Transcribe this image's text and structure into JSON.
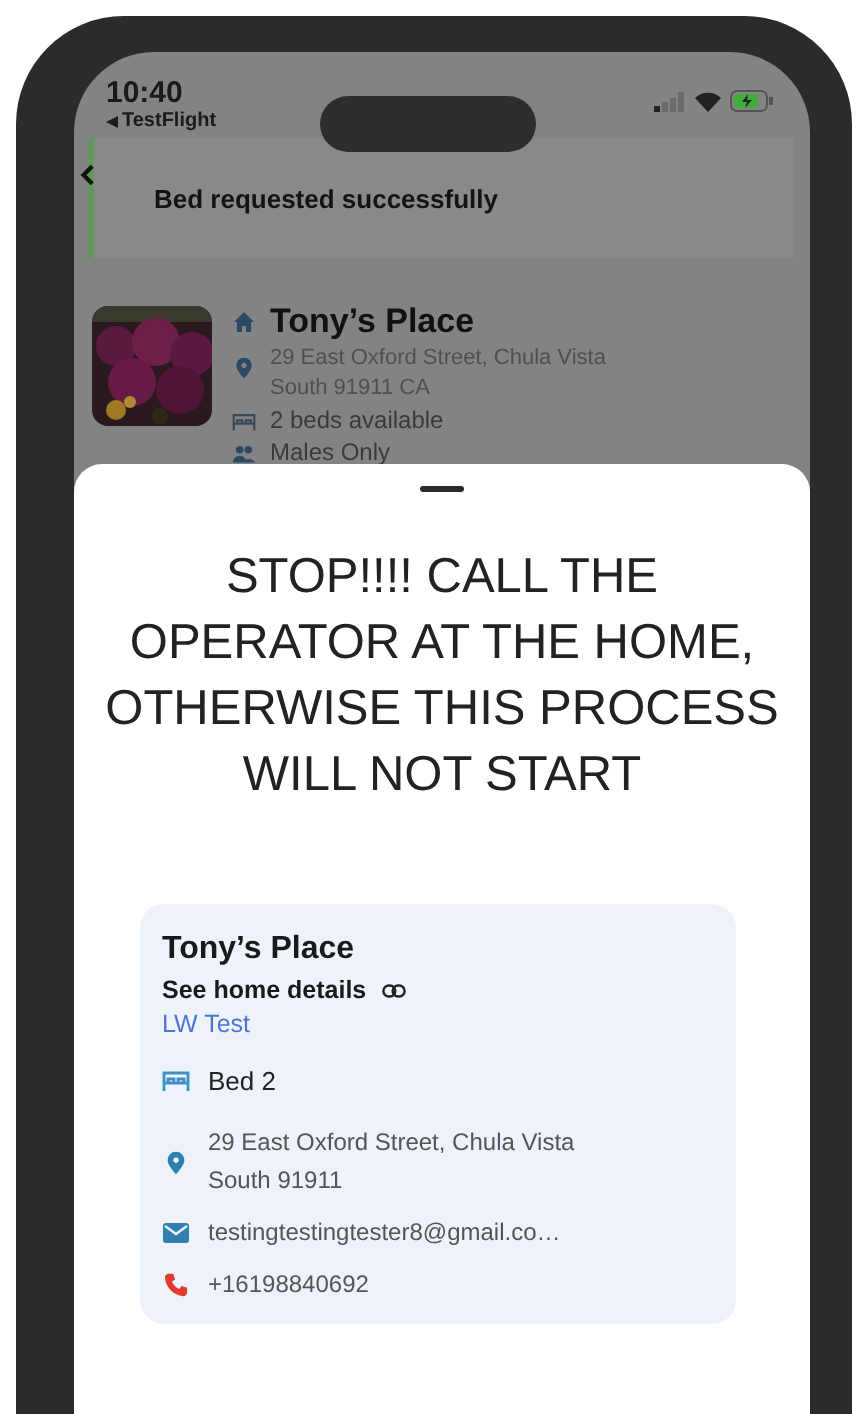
{
  "status_bar": {
    "time": "10:40",
    "back_app": "TestFlight"
  },
  "toast": {
    "message": "Bed requested successfully"
  },
  "home": {
    "name": "Tony’s Place",
    "address": "29 East Oxford Street, Chula Vista South 91911 CA",
    "beds": "2 beds available",
    "gender": "Males Only"
  },
  "sheet": {
    "title": "STOP!!!! CALL THE OPERATOR AT THE HOME, OTHERWISE THIS PROCESS WILL NOT START",
    "card": {
      "name": "Tony’s Place",
      "details_link": "See home details",
      "subtitle": "LW Test",
      "rows": [
        {
          "kind": "bed",
          "text": "Bed 2"
        },
        {
          "kind": "location",
          "text": "29 East Oxford Street, Chula Vista South 91911"
        },
        {
          "kind": "email",
          "text": "testingtestingtester8@gmail.co…"
        },
        {
          "kind": "phone",
          "text": "+16198840692"
        }
      ]
    }
  }
}
